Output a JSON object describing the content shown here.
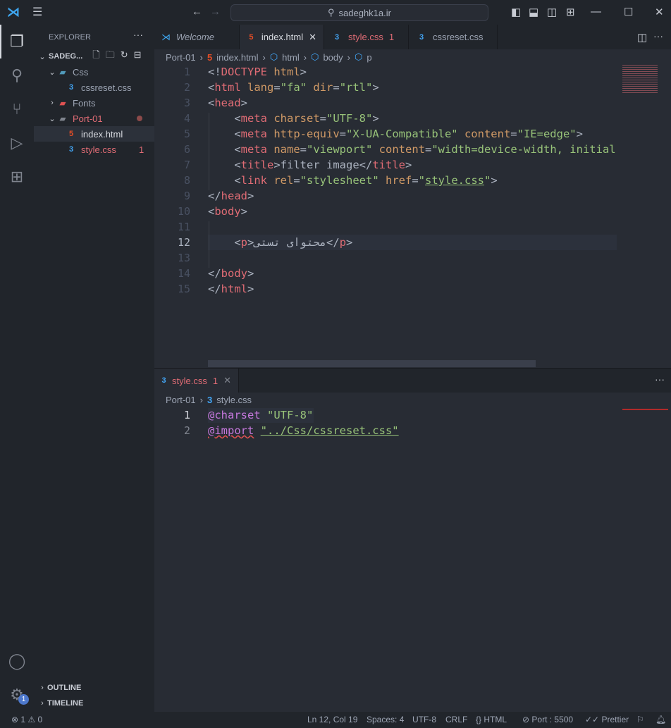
{
  "titlebar": {
    "search_text": "sadeghk1a.ir"
  },
  "sidebar": {
    "title": "EXPLORER",
    "root": "SADEG...",
    "items": [
      {
        "label": "Css",
        "type": "folder",
        "open": true,
        "color": "#9da5b4",
        "icon_color": "#519aba"
      },
      {
        "label": "cssreset.css",
        "type": "css",
        "color": "#9da5b4"
      },
      {
        "label": "Fonts",
        "type": "folder",
        "open": false,
        "color": "#9da5b4",
        "icon_color": "#e05252"
      },
      {
        "label": "Port-01",
        "type": "folder",
        "open": true,
        "color": "#e06c75",
        "modified": true
      },
      {
        "label": "index.html",
        "type": "html",
        "color": "#d7dae0",
        "selected": true
      },
      {
        "label": "style.css",
        "type": "css",
        "color": "#e06c75",
        "badge": "1"
      }
    ],
    "outline": "OUTLINE",
    "timeline": "TIMELINE"
  },
  "tabs": [
    {
      "label": "Welcome",
      "italic": true
    },
    {
      "label": "index.html",
      "active": true
    },
    {
      "label": "style.css",
      "badge": "1"
    },
    {
      "label": "cssreset.css"
    }
  ],
  "breadcrumb": [
    "Port-01",
    "index.html",
    "html",
    "body",
    "p"
  ],
  "html_code": [
    [
      [
        "p",
        "<!"
      ],
      [
        "t",
        "DOCTYPE"
      ],
      [
        "a",
        " html"
      ],
      [
        "p",
        ">"
      ]
    ],
    [
      [
        "p",
        "<"
      ],
      [
        "t",
        "html"
      ],
      [
        "a",
        " lang"
      ],
      [
        "p",
        "="
      ],
      [
        "s",
        "\"fa\""
      ],
      [
        "a",
        " dir"
      ],
      [
        "p",
        "="
      ],
      [
        "s",
        "\"rtl\""
      ],
      [
        "p",
        ">"
      ]
    ],
    [
      [
        "p",
        "<"
      ],
      [
        "t",
        "head"
      ],
      [
        "p",
        ">"
      ]
    ],
    [
      [
        "p",
        "    <"
      ],
      [
        "t",
        "meta"
      ],
      [
        "a",
        " charset"
      ],
      [
        "p",
        "="
      ],
      [
        "s",
        "\"UTF-8\""
      ],
      [
        "p",
        ">"
      ]
    ],
    [
      [
        "p",
        "    <"
      ],
      [
        "t",
        "meta"
      ],
      [
        "a",
        " http-equiv"
      ],
      [
        "p",
        "="
      ],
      [
        "s",
        "\"X-UA-Compatible\""
      ],
      [
        "a",
        " content"
      ],
      [
        "p",
        "="
      ],
      [
        "s",
        "\"IE=edge\""
      ],
      [
        "p",
        ">"
      ]
    ],
    [
      [
        "p",
        "    <"
      ],
      [
        "t",
        "meta"
      ],
      [
        "a",
        " name"
      ],
      [
        "p",
        "="
      ],
      [
        "s",
        "\"viewport\""
      ],
      [
        "a",
        " content"
      ],
      [
        "p",
        "="
      ],
      [
        "s",
        "\"width=device-width, initial"
      ]
    ],
    [
      [
        "p",
        "    <"
      ],
      [
        "t",
        "title"
      ],
      [
        "p",
        ">"
      ],
      [
        "x",
        "filter image"
      ],
      [
        "p",
        "</"
      ],
      [
        "t",
        "title"
      ],
      [
        "p",
        ">"
      ]
    ],
    [
      [
        "p",
        "    <"
      ],
      [
        "t",
        "link"
      ],
      [
        "a",
        " rel"
      ],
      [
        "p",
        "="
      ],
      [
        "s",
        "\"stylesheet\""
      ],
      [
        "a",
        " href"
      ],
      [
        "p",
        "="
      ],
      [
        "s",
        "\""
      ],
      [
        "s u",
        "style.css"
      ],
      [
        "s",
        "\""
      ],
      [
        "p",
        ">"
      ]
    ],
    [
      [
        "p",
        "</"
      ],
      [
        "t",
        "head"
      ],
      [
        "p",
        ">"
      ]
    ],
    [
      [
        "p",
        "<"
      ],
      [
        "t",
        "body"
      ],
      [
        "p",
        ">"
      ]
    ],
    [],
    [
      [
        "p",
        "    <"
      ],
      [
        "t",
        "p"
      ],
      [
        "p",
        ">"
      ],
      [
        "x",
        "محتوای تستی"
      ],
      [
        "p",
        "</"
      ],
      [
        "t",
        "p"
      ],
      [
        "p",
        ">"
      ]
    ],
    [],
    [
      [
        "p",
        "</"
      ],
      [
        "t",
        "body"
      ],
      [
        "p",
        ">"
      ]
    ],
    [
      [
        "p",
        "</"
      ],
      [
        "t",
        "html"
      ],
      [
        "p",
        ">"
      ]
    ]
  ],
  "current_line": 12,
  "bottom": {
    "tab": "style.css",
    "tab_badge": "1",
    "breadcrumb": [
      "Port-01",
      "style.css"
    ],
    "code": [
      [
        [
          "k",
          "@charset"
        ],
        [
          "p",
          " "
        ],
        [
          "s",
          "\"UTF-8\""
        ]
      ],
      [
        [
          "k w",
          "@import"
        ],
        [
          "p",
          " "
        ],
        [
          "s u",
          "\"../Css/cssreset.css\""
        ]
      ]
    ]
  },
  "status": {
    "errors": "1",
    "warnings": "0",
    "position": "Ln 12, Col 19",
    "spaces": "Spaces: 4",
    "encoding": "UTF-8",
    "eol": "CRLF",
    "language": "HTML",
    "port": "Port : 5500",
    "prettier": "Prettier"
  },
  "colors": {
    "html_icon": "#e44d26",
    "css_icon": "#42a5f5",
    "accent": "#4d78cc"
  }
}
